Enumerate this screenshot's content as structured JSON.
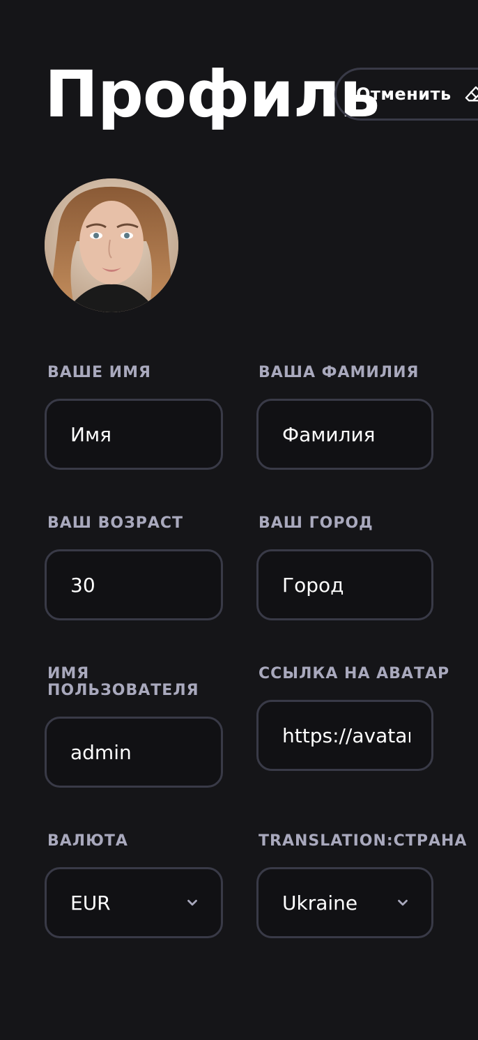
{
  "page": {
    "title": "Профиль"
  },
  "header": {
    "cancel_label": "Отменить",
    "cancel_icon": "eraser-icon"
  },
  "avatar": {
    "description_icon": "user-avatar-photo"
  },
  "form": {
    "first_name": {
      "label": "ВАШЕ ИМЯ",
      "value": "Имя"
    },
    "last_name": {
      "label": "ВАША ФАМИЛИЯ",
      "value": "Фамилия"
    },
    "age": {
      "label": "ВАШ ВОЗРАСТ",
      "value": "30"
    },
    "city": {
      "label": "ВАШ ГОРОД",
      "value": "Город"
    },
    "username": {
      "label": "ИМЯ ПОЛЬЗОВАТЕЛЯ",
      "value": "admin"
    },
    "avatar_link": {
      "label": "ССЫЛКА НА АВАТАР",
      "value": "https://avatars.githubusercontent.com"
    },
    "currency": {
      "label": "ВАЛЮТА",
      "value": "EUR",
      "icon": "chevron-down-icon"
    },
    "country": {
      "label": "TRANSLATION:СТРАНА",
      "value": "Ukraine",
      "icon": "chevron-down-icon"
    }
  },
  "colors": {
    "background": "#151518",
    "border": "#393a47",
    "label": "#a9a9bd",
    "text": "#ffffff"
  }
}
